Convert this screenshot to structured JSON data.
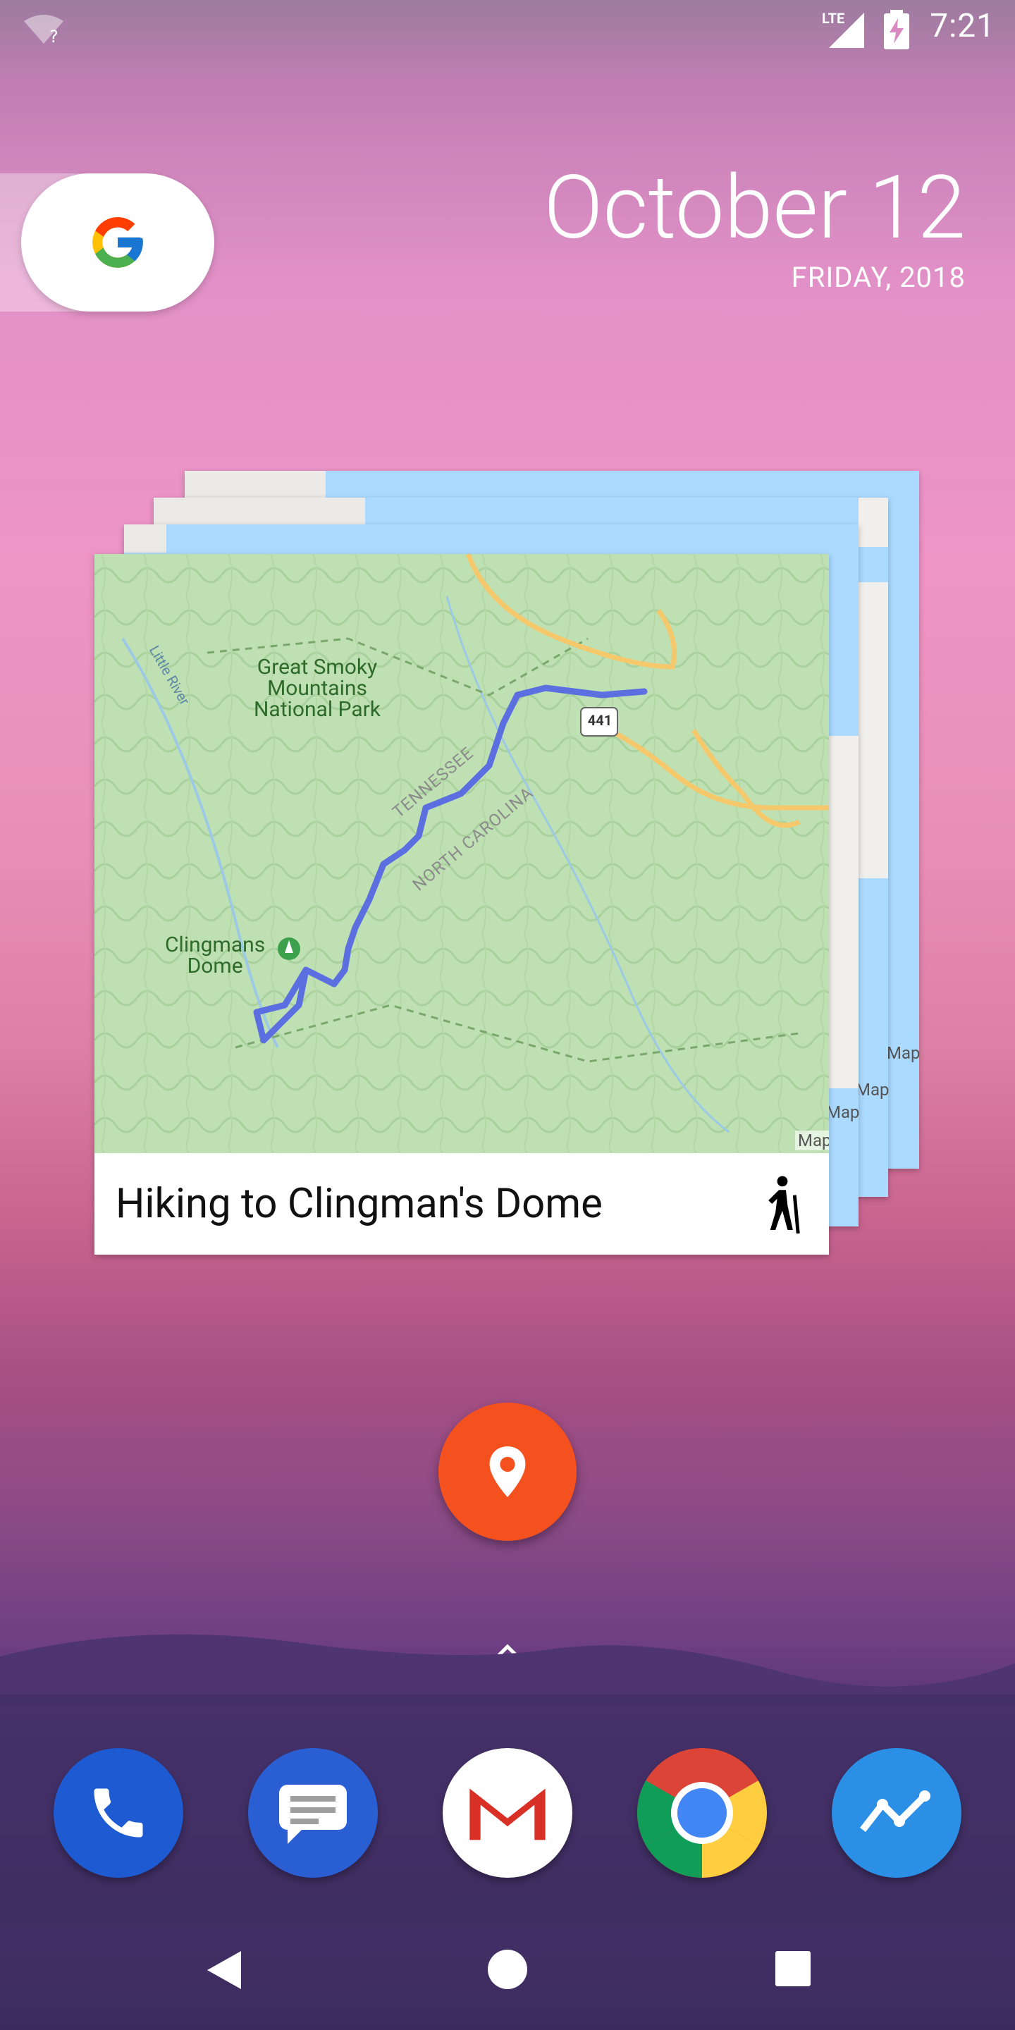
{
  "status_bar": {
    "time": "7:21",
    "network": "LTE"
  },
  "date_widget": {
    "date": "October 12",
    "weekday_year": "FRIDAY, 2018"
  },
  "card": {
    "title": "Hiking to Clingman's Dome",
    "activity_icon": "hiking-icon",
    "map_attribution": "Map",
    "map_labels": {
      "park": [
        "Great Smoky",
        "Mountains",
        "National Park"
      ],
      "state1": "TENNESSEE",
      "state2": "NORTH CAROLINA",
      "poi": [
        "Clingmans",
        "Dome"
      ],
      "river": "Little River",
      "route_shield": "441"
    }
  },
  "back_card_labels": {
    "attr1": "Map",
    "attr2": "Map",
    "attr3": "Map"
  },
  "fab": {
    "icon": "location-pin-icon"
  },
  "dock": {
    "apps": [
      {
        "name": "Phone",
        "icon": "phone-icon",
        "color": "#1e5bd3"
      },
      {
        "name": "Messages",
        "icon": "messages-icon",
        "color": "#2a5fd4"
      },
      {
        "name": "Gmail",
        "icon": "gmail-icon",
        "color": "#ffffff"
      },
      {
        "name": "Chrome",
        "icon": "chrome-icon",
        "color": "#db4437"
      },
      {
        "name": "Trends",
        "icon": "trend-line-icon",
        "color": "#2b8fe6"
      }
    ]
  },
  "colors": {
    "fab": "#f4511e",
    "route": "#5b6fe0",
    "map_green": "#bfe0b3",
    "water_blue": "#aadaff"
  }
}
